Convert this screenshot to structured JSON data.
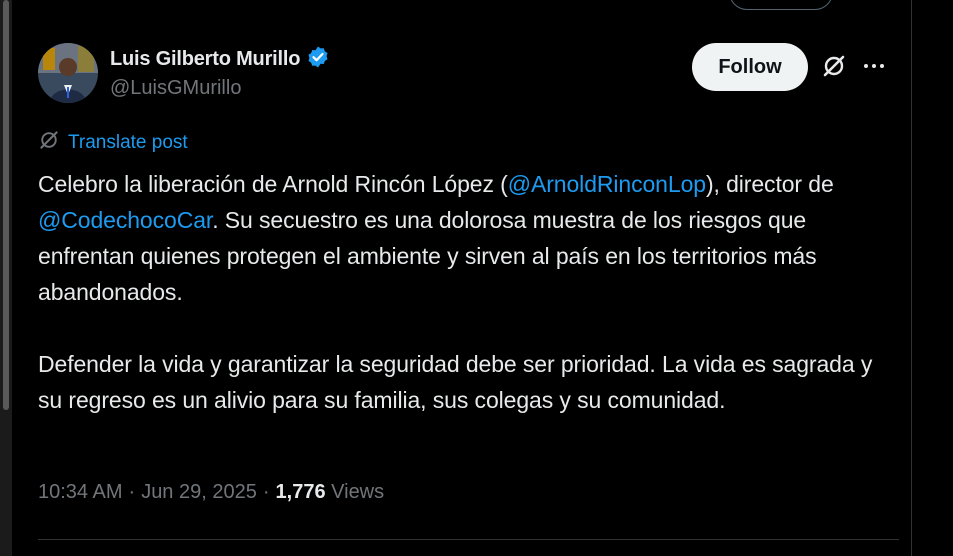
{
  "author": {
    "name": "Luis Gilberto Murillo",
    "handle": "@LuisGMurillo",
    "verified": true
  },
  "actions": {
    "follow_label": "Follow",
    "grok_icon": "grok-icon",
    "more_icon": "more-icon"
  },
  "translate": {
    "label": "Translate post"
  },
  "tweet": {
    "p1_a": "Celebro la liberación de Arnold Rincón López (",
    "p1_mention1": "@ArnoldRinconLop",
    "p1_b": "), director de ",
    "p1_mention2": "@CodechocoCar",
    "p1_c": ". Su secuestro es una dolorosa muestra de los riesgos que enfrentan quienes protegen el ambiente y sirven al país en los territorios más abandonados.",
    "p2": "Defender la vida y garantizar la seguridad debe ser prioridad. La vida es sagrada y su regreso es un alivio para su familia, sus colegas y su comunidad."
  },
  "meta": {
    "time": "10:34 AM",
    "sep1": "·",
    "date": "Jun 29, 2025",
    "sep2": "·",
    "views_count": "1,776",
    "views_label": "Views"
  },
  "colors": {
    "background": "#000000",
    "link": "#1d9bf0",
    "text": "#e7e9ea",
    "muted": "#71767b",
    "verified": "#1d9bf0"
  }
}
